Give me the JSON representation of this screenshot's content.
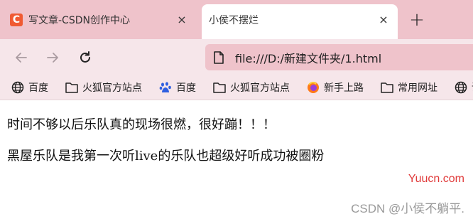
{
  "tabs": [
    {
      "favicon_text": "C",
      "title": "写文章-CSDN创作中心",
      "close": "×"
    },
    {
      "title": "小侯不摆烂",
      "close": "×"
    }
  ],
  "new_tab_symbol": "+",
  "toolbar": {
    "url": "file:///D:/新建文件夹/1.html"
  },
  "bookmarks": [
    {
      "icon": "globe-icon",
      "label": "百度"
    },
    {
      "icon": "folder-icon",
      "label": "火狐官方站点"
    },
    {
      "icon": "baidu-paw-icon",
      "label": "百度"
    },
    {
      "icon": "folder-icon",
      "label": "火狐官方站点"
    },
    {
      "icon": "firefox-icon",
      "label": "新手上路"
    },
    {
      "icon": "folder-icon",
      "label": "常用网址"
    },
    {
      "icon": "globe-icon",
      "label": "课程"
    }
  ],
  "content": {
    "lines": [
      "时间不够以后乐队真的现场很燃，很好蹦！！！",
      "黑屋乐队是我第一次听live的乐队也超级好听成功被圈粉"
    ]
  },
  "watermarks": {
    "site": "Yuucn.com",
    "author": "CSDN @小侯不躺平."
  },
  "colors": {
    "tabstrip": "#efc3cb",
    "toolbar": "#f6e6ea",
    "csdn_brand": "#f05a32",
    "watermark_red": "#e03a3a"
  }
}
